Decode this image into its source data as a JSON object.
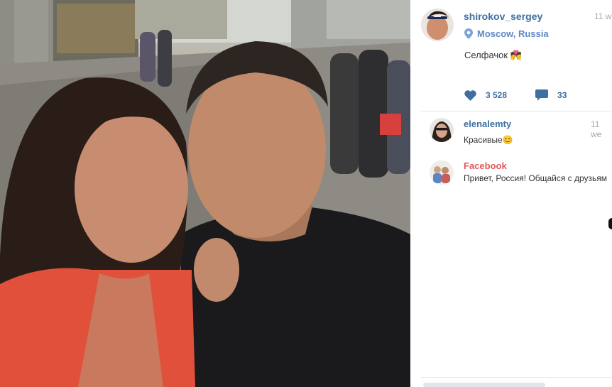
{
  "post": {
    "username": "shirokov_sergey",
    "time": "11 w",
    "location": "Moscow, Russia",
    "caption": "Селфачок 💏",
    "likes": "3 528",
    "comments": "33"
  },
  "comments": [
    {
      "username": "elenalemty",
      "time": "11 we",
      "text": "Красивые😊"
    },
    {
      "username": "Facebook",
      "text": "Привет, Россия! Общайся с друзьям"
    }
  ],
  "icons": {
    "location": "location-pin-icon",
    "likes": "heart-icon",
    "comments": "speech-bubble-icon"
  },
  "colors": {
    "username": "#3f6fa0",
    "location": "#5d88c6",
    "facebook": "#e05a5a"
  }
}
